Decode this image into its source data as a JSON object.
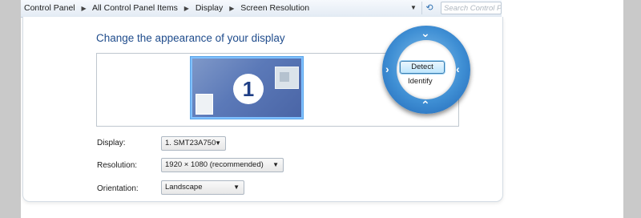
{
  "breadcrumb": [
    "Control Panel",
    "All Control Panel Items",
    "Display",
    "Screen Resolution"
  ],
  "search": {
    "placeholder": "Search Control P"
  },
  "page": {
    "title": "Change the appearance of your display"
  },
  "monitor": {
    "number": "1"
  },
  "zoom": {
    "detect_label": "Detect",
    "identify_label": "Identify"
  },
  "form": {
    "display": {
      "label": "Display:",
      "value": "1. SMT23A750"
    },
    "resolution": {
      "label": "Resolution:",
      "value": "1920 × 1080 (recommended)"
    },
    "orientation": {
      "label": "Orientation:",
      "value": "Landscape"
    }
  },
  "icons": {
    "crumb_separator": "chevron-right-icon",
    "dropdown": "chevron-down-icon",
    "refresh": "refresh-icon"
  },
  "colors": {
    "title": "#1f4c8c",
    "accent": "#3f8fd4",
    "monitor": "#5b79b8"
  }
}
